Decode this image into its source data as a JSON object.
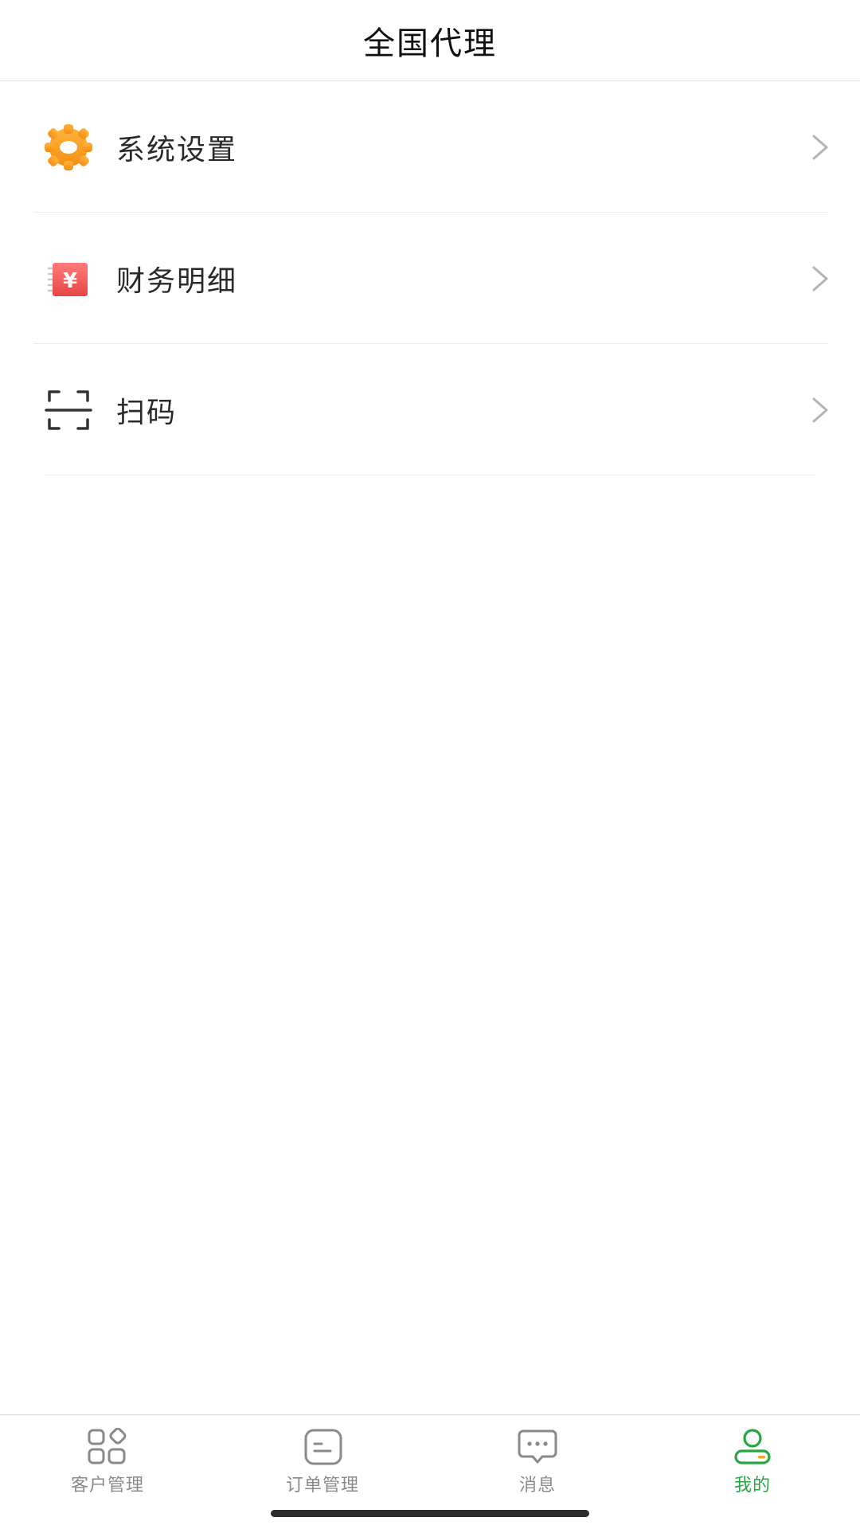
{
  "header": {
    "title": "全国代理"
  },
  "menu": {
    "items": [
      {
        "label": "系统设置",
        "icon": "gear-icon"
      },
      {
        "label": "财务明细",
        "icon": "finance-receipt-icon"
      },
      {
        "label": "扫码",
        "icon": "scan-frame-icon"
      }
    ]
  },
  "tabbar": {
    "tabs": [
      {
        "label": "客户管理",
        "icon": "grid-apps-icon"
      },
      {
        "label": "订单管理",
        "icon": "order-doc-icon"
      },
      {
        "label": "消息",
        "icon": "chat-bubble-icon"
      },
      {
        "label": "我的",
        "icon": "profile-icon",
        "active": true
      }
    ],
    "active_color": "#26a742",
    "inactive_color": "#8a8a8a"
  },
  "colors": {
    "gear": "#f5a623",
    "finance": "#f25c5c"
  }
}
